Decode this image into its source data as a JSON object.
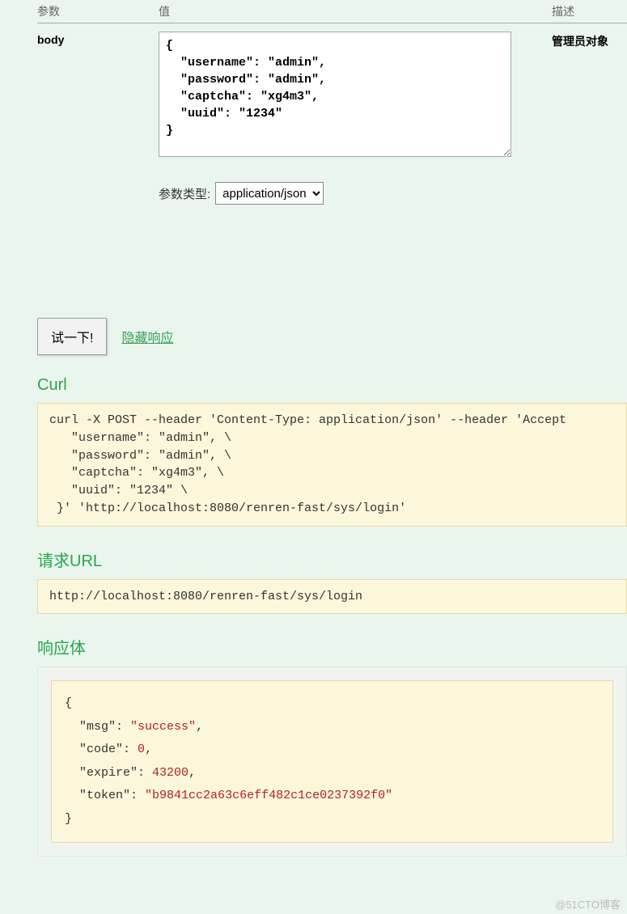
{
  "headers": {
    "param": "参数",
    "value": "值",
    "desc": "描述"
  },
  "param": {
    "name": "body",
    "body_value": "{\n  \"username\": \"admin\",\n  \"password\": \"admin\",\n  \"captcha\": \"xg4m3\",\n  \"uuid\": \"1234\"\n}",
    "desc": "管理员对象",
    "type_label": "参数类型:",
    "type_options": [
      "application/json"
    ],
    "type_selected": "application/json"
  },
  "actions": {
    "try_label": "试一下!",
    "hide_label": "隐藏响应"
  },
  "sections": {
    "curl_title": "Curl",
    "curl_text": "curl -X POST --header 'Content-Type: application/json' --header 'Accept\n   \"username\": \"admin\", \\\n   \"password\": \"admin\", \\\n   \"captcha\": \"xg4m3\", \\\n   \"uuid\": \"1234\" \\\n }' 'http://localhost:8080/renren-fast/sys/login'",
    "url_title": "请求URL",
    "url_text": "http://localhost:8080/renren-fast/sys/login",
    "resp_title": "响应体",
    "resp_json": {
      "msg": "success",
      "code": 0,
      "expire": 43200,
      "token": "b9841cc2a63c6eff482c1ce0237392f0"
    }
  },
  "watermark": "@51CTO博客"
}
